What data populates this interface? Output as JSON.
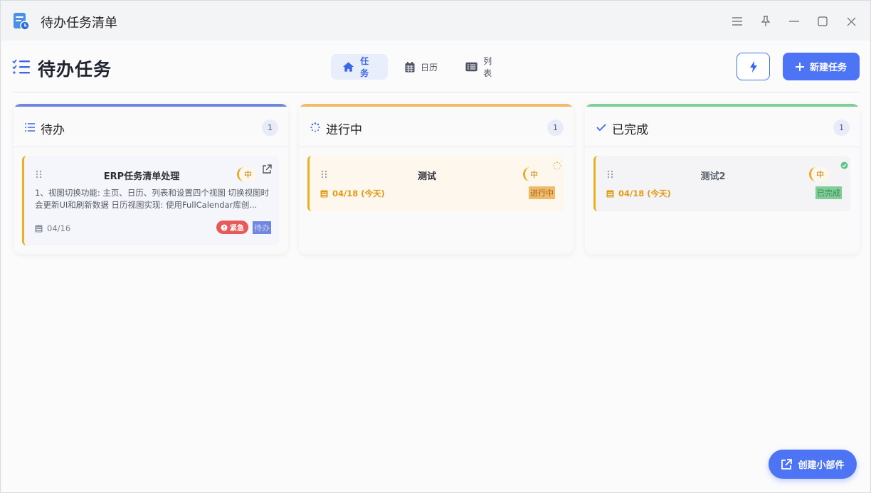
{
  "window": {
    "title": "待办任务清单"
  },
  "header": {
    "title": "待办任务"
  },
  "view_tabs": [
    {
      "label": "任务",
      "icon": "home-icon",
      "active": true
    },
    {
      "label": "日历",
      "icon": "calendar-icon",
      "active": false
    },
    {
      "label": "列表",
      "icon": "list-icon",
      "active": false
    }
  ],
  "toolbar": {
    "quick_icon": "lightning-icon",
    "new_task_label": "新建任务"
  },
  "columns": [
    {
      "title": "待办",
      "count": "1",
      "accent": "#6f86e0",
      "cards": [
        {
          "title": "ERP任务清单处理",
          "priority": "中",
          "description": "1、视图切换功能: 主页、日历、列表和设置四个视图 切换视图时会更新UI和刷新数据 日历视图实现: 使用FullCalendar库创...",
          "date": "04/16",
          "badge": "紧急",
          "status": "待办"
        }
      ]
    },
    {
      "title": "进行中",
      "count": "1",
      "accent": "#efba6a",
      "cards": [
        {
          "title": "测试",
          "priority": "中",
          "date": "04/18 (今天)",
          "status": "进行中"
        }
      ]
    },
    {
      "title": "已完成",
      "count": "1",
      "accent": "#7fce98",
      "cards": [
        {
          "title": "测试2",
          "priority": "中",
          "date": "04/18 (今天)",
          "status": "已完成"
        }
      ]
    }
  ],
  "widget_button": {
    "label": "创建小部件"
  },
  "colors": {
    "primary": "#4d74f5",
    "due_orange": "#e29a12",
    "urgent_red": "#e85a5a"
  }
}
